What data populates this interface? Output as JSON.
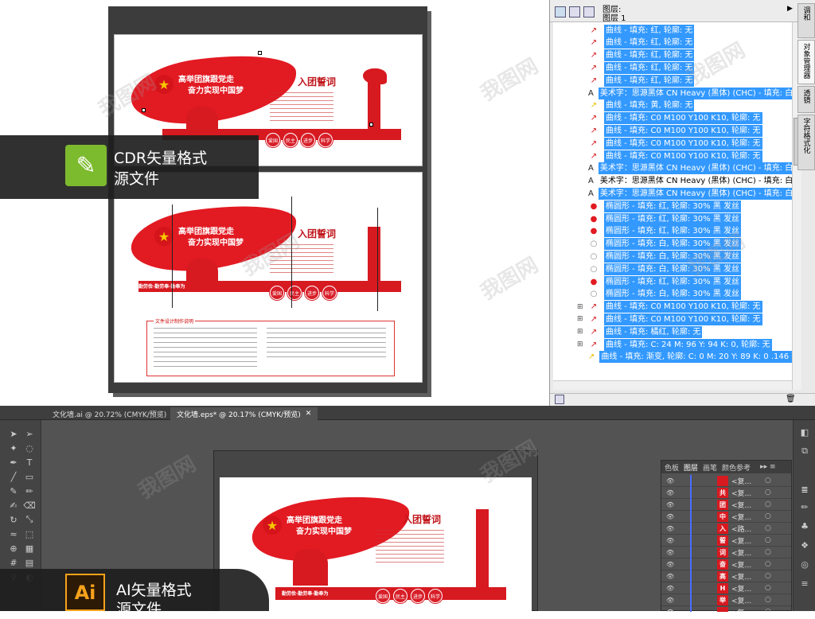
{
  "cdr": {
    "label_line1": "CDR矢量格式",
    "label_line2": "源文件"
  },
  "artwork": {
    "flag_line1": "高举团旗跟党走",
    "flag_line2": "奋力实现中国梦",
    "flag_line2_alt": "奋力实现中国梦",
    "flag_line1_alt": "高举团旗跟党走",
    "oath_title": "入团誓词",
    "banner": "勤劳俭·勤劳奉·勤奉为",
    "badges": [
      "爱国",
      "民主",
      "进步",
      "科学"
    ],
    "notes_title": "文件设计制作说明"
  },
  "object_manager": {
    "header_line1": "图层:",
    "header_line2": "图层 1",
    "side_tabs": [
      "调和",
      "对象管理器",
      "透镜",
      "字符格式化"
    ],
    "rows": [
      {
        "icon": "curve",
        "text": "曲线 - 填充: 红, 轮廓: 无",
        "selected": true
      },
      {
        "icon": "curve",
        "text": "曲线 - 填充: 红, 轮廓: 无",
        "selected": true
      },
      {
        "icon": "curve",
        "text": "曲线 - 填充: 红, 轮廓: 无",
        "selected": true
      },
      {
        "icon": "curve",
        "text": "曲线 - 填充: 红, 轮廓: 无",
        "selected": true
      },
      {
        "icon": "curve",
        "text": "曲线 - 填充: 红, 轮廓: 无",
        "selected": true
      },
      {
        "icon": "artistic",
        "text": "美术字：思源黑体 CN Heavy (黑体) (CHC) - 填充: 白, 轮",
        "selected": true
      },
      {
        "icon": "curve-yellow",
        "text": "曲线 - 填充: 黄, 轮廓: 无",
        "selected": true
      },
      {
        "icon": "curve",
        "text": "曲线 - 填充: C0 M100 Y100 K10, 轮廓: 无",
        "selected": true
      },
      {
        "icon": "curve",
        "text": "曲线 - 填充: C0 M100 Y100 K10, 轮廓: 无",
        "selected": true
      },
      {
        "icon": "curve",
        "text": "曲线 - 填充: C0 M100 Y100 K10, 轮廓: 无",
        "selected": true
      },
      {
        "icon": "curve",
        "text": "曲线 - 填充: C0 M100 Y100 K10, 轮廓: 无",
        "selected": true
      },
      {
        "icon": "artistic",
        "text": "美术字：思源黑体 CN Heavy (黑体) (CHC) - 填充: 白, 轮",
        "selected": true
      },
      {
        "icon": "artistic",
        "text": "美术字：思源黑体 CN Heavy (黑体) (CHC) - 填充: 白, 轮廓: 无",
        "selected": false
      },
      {
        "icon": "artistic",
        "text": "美术字：思源黑体 CN Heavy (黑体) (CHC) - 填充: 白, 轮",
        "selected": true
      },
      {
        "icon": "ellipse-red",
        "text": "椭圆形 - 填充: 红, 轮廓: 30% 黑 发丝",
        "selected": true
      },
      {
        "icon": "ellipse-red",
        "text": "椭圆形 - 填充: 红, 轮廓: 30% 黑 发丝",
        "selected": true
      },
      {
        "icon": "ellipse-red",
        "text": "椭圆形 - 填充: 红, 轮廓: 30% 黑 发丝",
        "selected": true
      },
      {
        "icon": "ellipse-white",
        "text": "椭圆形 - 填充: 白, 轮廓: 30% 黑 发丝",
        "selected": true
      },
      {
        "icon": "ellipse-white",
        "text": "椭圆形 - 填充: 白, 轮廓: 30% 黑 发丝",
        "selected": true
      },
      {
        "icon": "ellipse-white",
        "text": "椭圆形 - 填充: 白, 轮廓: 30% 黑 发丝",
        "selected": true
      },
      {
        "icon": "ellipse-red",
        "text": "椭圆形 - 填充: 红, 轮廓: 30% 黑 发丝",
        "selected": true
      },
      {
        "icon": "ellipse-white",
        "text": "椭圆形 - 填充: 白, 轮廓: 30% 黑 发丝",
        "selected": true
      },
      {
        "icon": "curve-group",
        "text": "曲线 - 填充: C0 M100 Y100 K10, 轮廓: 无",
        "selected": true
      },
      {
        "icon": "curve-group",
        "text": "曲线 - 填充: C0 M100 Y100 K10, 轮廓: 无",
        "selected": true
      },
      {
        "icon": "curve-group",
        "text": "曲线 - 填充: 橘红, 轮廓: 无",
        "selected": true
      },
      {
        "icon": "curve-group",
        "text": "曲线 - 填充: C: 24 M: 96 Y: 94 K: 0, 轮廓: 无",
        "selected": true
      },
      {
        "icon": "curve-yellow",
        "text": "曲线 - 填充: 渐变, 轮廓: C: 0 M: 20 Y: 89 K: 0  .146 毫",
        "selected": true
      }
    ]
  },
  "illustrator": {
    "tabs": [
      {
        "label": "文化墙.ai @ 20.72% (CMYK/预览)",
        "active": false
      },
      {
        "label": "文化墙.eps* @ 20.17% (CMYK/预览)",
        "active": true
      }
    ],
    "label_line1": "AI矢量格式",
    "label_line2": "源文件",
    "layers_tabs": [
      "色板",
      "图层",
      "画笔",
      "颜色参考"
    ],
    "layer_rows": [
      {
        "thumb": "",
        "name": "<复..."
      },
      {
        "thumb": "共",
        "name": "<复..."
      },
      {
        "thumb": "团",
        "name": "<复..."
      },
      {
        "thumb": "中",
        "name": "<复..."
      },
      {
        "thumb": "入",
        "name": "<路..."
      },
      {
        "thumb": "誓",
        "name": "<复..."
      },
      {
        "thumb": "词",
        "name": "<复..."
      },
      {
        "thumb": "奋",
        "name": "<复..."
      },
      {
        "thumb": "高",
        "name": "<复..."
      },
      {
        "thumb": "H",
        "name": "<复..."
      },
      {
        "thumb": "举",
        "name": "<复..."
      },
      {
        "thumb": "",
        "name": "<复..."
      }
    ]
  },
  "watermark": "我图网",
  "colors": {
    "brand_red": "#e21a22",
    "selection_blue": "#3399ff",
    "ai_dark": "#535353"
  }
}
